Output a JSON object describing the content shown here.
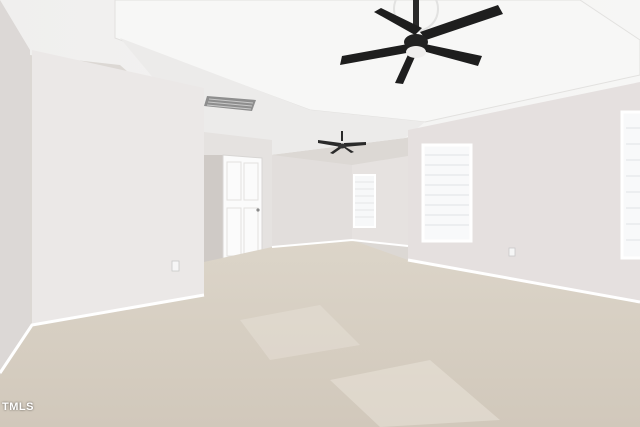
{
  "watermark": {
    "text": "TMLS"
  },
  "colors": {
    "wall_left": "#e4e0de",
    "wall_right": "#e6e1e0",
    "ceiling": "#f3f2f1",
    "carpet": "#d8d0c4",
    "trim": "#ffffff",
    "fan": "#1e1e1e"
  },
  "icons": {
    "ceiling_fan_main": "ceiling-fan-icon",
    "ceiling_fan_far": "ceiling-fan-icon",
    "hvac_vent": "air-vent-icon",
    "outlet": "outlet-icon"
  }
}
